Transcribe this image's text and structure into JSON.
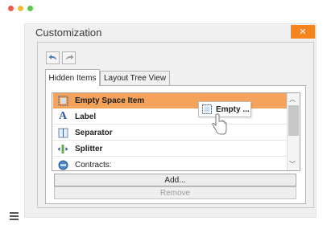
{
  "window_controls": {
    "close_color": "#ee5b4e",
    "minimize_color": "#f4bb3a",
    "maximize_color": "#5bc84c"
  },
  "dialog": {
    "title": "Customization",
    "close_glyph": "✕",
    "accent_color": "#f5841f"
  },
  "toolbar": {
    "undo_icon": "undo-icon",
    "redo_icon": "redo-icon"
  },
  "tabs": [
    {
      "label": "Hidden Items",
      "active": true
    },
    {
      "label": "Layout Tree View",
      "active": false
    }
  ],
  "hidden_items": [
    {
      "label": "Empty Space Item",
      "icon": "empty-space-icon",
      "selected": true
    },
    {
      "label": "Label",
      "icon": "label-icon",
      "selected": false
    },
    {
      "label": "Separator",
      "icon": "separator-icon",
      "selected": false
    },
    {
      "label": "Splitter",
      "icon": "splitter-icon",
      "selected": false
    },
    {
      "label": "Contracts:",
      "icon": "contracts-icon",
      "selected": false
    }
  ],
  "drag_preview": {
    "label": "Empty ..."
  },
  "buttons": {
    "add_label": "Add...",
    "remove_label": "Remove"
  }
}
